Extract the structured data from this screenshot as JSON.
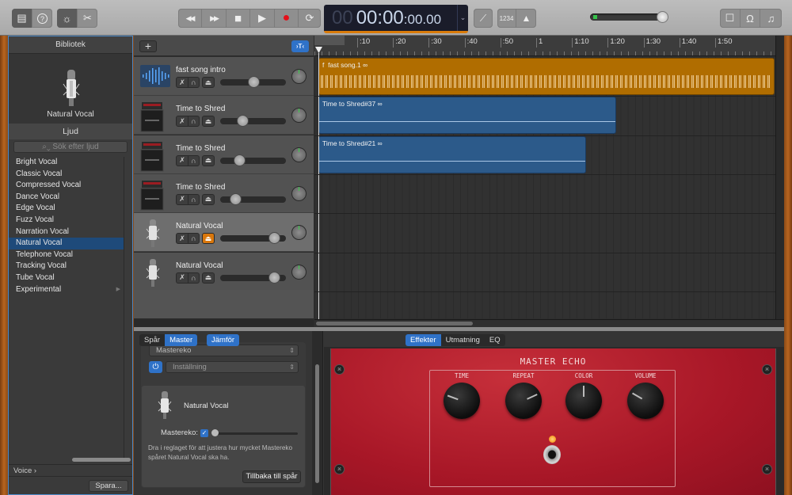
{
  "toolbar": {
    "left_group": [
      {
        "icon": "library-icon",
        "active": true
      },
      {
        "icon": "help-icon",
        "active": false
      }
    ],
    "edit_group": [
      {
        "icon": "smart-controls-icon",
        "active": true
      },
      {
        "icon": "scissors-icon",
        "active": false
      }
    ],
    "transport": [
      {
        "icon": "rewind-icon",
        "glyph": "◀◀"
      },
      {
        "icon": "fast-forward-icon",
        "glyph": "▶▶"
      },
      {
        "icon": "stop-icon",
        "glyph": "■"
      },
      {
        "icon": "play-icon",
        "glyph": "▶"
      },
      {
        "icon": "record-icon",
        "glyph": "●"
      },
      {
        "icon": "cycle-icon",
        "glyph": "⟳"
      }
    ],
    "lcd": {
      "hours": "00",
      "minutes_seconds": "00:00",
      "fraction": ":00.00"
    },
    "tuner_glyph": "𝄞",
    "count_in_label": "1234",
    "metronome_glyph": "⏅",
    "master_volume": 0.93,
    "right_group": [
      {
        "icon": "notepad-icon",
        "glyph": "☐"
      },
      {
        "icon": "loop-browser-icon",
        "glyph": "Ω"
      },
      {
        "icon": "media-browser-icon",
        "glyph": "♫"
      }
    ]
  },
  "library": {
    "header": "Bibliotek",
    "patch_name": "Natural Vocal",
    "section": "Ljud",
    "search_placeholder": "Sök efter ljud",
    "items": [
      {
        "label": "Bright Vocal",
        "selected": false
      },
      {
        "label": "Classic Vocal",
        "selected": false
      },
      {
        "label": "Compressed Vocal",
        "selected": false
      },
      {
        "label": "Dance Vocal",
        "selected": false
      },
      {
        "label": "Edge Vocal",
        "selected": false
      },
      {
        "label": "Fuzz Vocal",
        "selected": false
      },
      {
        "label": "Narration Vocal",
        "selected": false
      },
      {
        "label": "Natural Vocal",
        "selected": true
      },
      {
        "label": "Telephone Vocal",
        "selected": false
      },
      {
        "label": "Tracking Vocal",
        "selected": false
      },
      {
        "label": "Tube Vocal",
        "selected": false
      },
      {
        "label": "Experimental",
        "selected": false,
        "has_submenu": true
      }
    ],
    "breadcrumb": "Voice  ›",
    "save_label": "Spara..."
  },
  "tracks_header": {
    "add_label": "+",
    "smart_label": "›T‹"
  },
  "tracks": [
    {
      "name": "fast song intro",
      "type": "audio",
      "volume": 0.6,
      "record_armed": false,
      "selected": false
    },
    {
      "name": "Time to Shred",
      "type": "amp",
      "volume": 0.4,
      "record_armed": false,
      "selected": false
    },
    {
      "name": "Time to Shred",
      "type": "amp",
      "volume": 0.34,
      "record_armed": false,
      "selected": false
    },
    {
      "name": "Time to Shred",
      "type": "amp",
      "volume": 0.27,
      "record_armed": false,
      "selected": false
    },
    {
      "name": "Natural Vocal",
      "type": "mic",
      "volume": 0.97,
      "record_armed": true,
      "selected": true
    },
    {
      "name": "Natural Vocal",
      "type": "mic",
      "volume": 0.97,
      "record_armed": false,
      "selected": false
    }
  ],
  "ruler": {
    "labels": [
      ":10",
      ":20",
      ":30",
      ":40",
      ":50",
      "1",
      "1:10",
      "1:20",
      "1:30",
      "1:40",
      "1:50"
    ]
  },
  "regions": [
    {
      "name": "fast song.1",
      "track": 0,
      "color": "orange",
      "prefix": "f"
    },
    {
      "name": "Time to Shred#37",
      "track": 1,
      "color": "blue"
    },
    {
      "name": "Time to Shred#21",
      "track": 2,
      "color": "blue"
    }
  ],
  "editor": {
    "left_tabs": [
      {
        "label": "Spår",
        "active": false
      },
      {
        "label": "Master",
        "active": true
      }
    ],
    "compare_label": "Jämför",
    "right_tabs": [
      {
        "label": "Effekter",
        "active": true
      },
      {
        "label": "Utmatning",
        "active": false
      },
      {
        "label": "EQ",
        "active": false
      }
    ],
    "plugin_popup": "Mastereko",
    "preset_popup": "Inställning",
    "card": {
      "title": "Natural Vocal",
      "send_label": "Mastereko:",
      "send_enabled": true,
      "send_amount": 0.0,
      "help_text": "Dra i reglaget för att justera hur mycket Mastereko spåret Natural Vocal ska ha.",
      "back_label": "Tillbaka till spår"
    },
    "plugin": {
      "title": "MASTER ECHO",
      "knobs": [
        {
          "label": "TIME",
          "angle": -70
        },
        {
          "label": "REPEAT",
          "angle": 65
        },
        {
          "label": "COLOR",
          "angle": 0
        },
        {
          "label": "VOLUME",
          "angle": -60
        }
      ],
      "power_on": true
    }
  }
}
